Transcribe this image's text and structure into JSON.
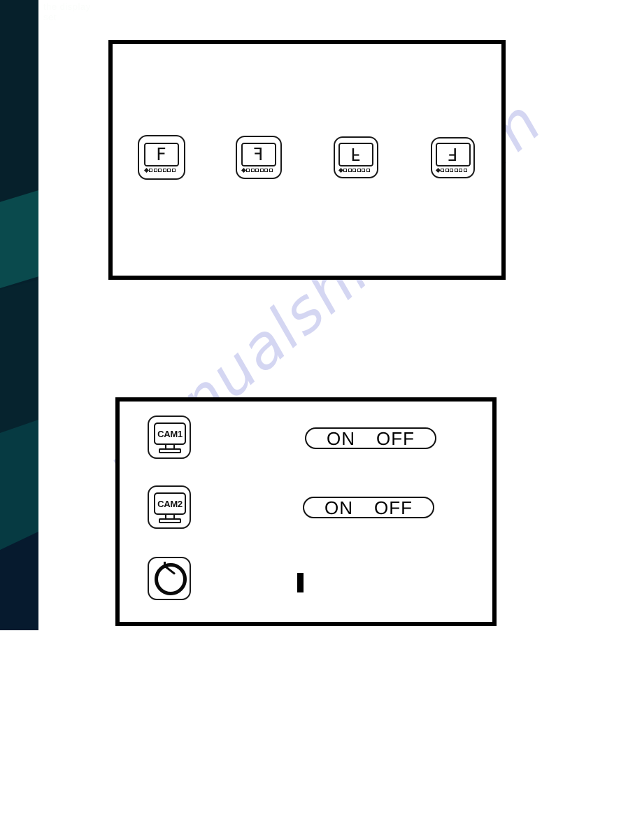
{
  "page": {
    "faint_header_line1": "the display",
    "faint_header_line2": "set",
    "watermark": "manualshive.com"
  },
  "sidebar": {
    "name": "decorative-sidebar",
    "colors": [
      "#06202b",
      "#0a4a4d",
      "#06232e",
      "#063a42",
      "#061a2e"
    ]
  },
  "orientation_panel": {
    "title": "",
    "icons": [
      {
        "id": "normal",
        "glyph": "F",
        "flip": "none",
        "label": "normal-orientation"
      },
      {
        "id": "mirror",
        "glyph": "F",
        "flip": "h",
        "label": "mirror-horizontal"
      },
      {
        "id": "flip",
        "glyph": "F",
        "flip": "v",
        "label": "flip-vertical"
      },
      {
        "id": "mirror-and-flip",
        "glyph": "F",
        "flip": "hv",
        "label": "rotate-180"
      }
    ]
  },
  "camera_panel": {
    "rows": [
      {
        "icon_label": "CAM1",
        "icon_name": "cam1-monitor-icon",
        "toggle": {
          "on": "ON",
          "off": "OFF"
        }
      },
      {
        "icon_label": "CAM2",
        "icon_name": "cam2-monitor-icon",
        "toggle": {
          "on": "ON",
          "off": "OFF"
        }
      },
      {
        "icon_label": "",
        "icon_name": "timer-clock-icon",
        "toggle": null
      }
    ],
    "cursor_mark": "|"
  }
}
